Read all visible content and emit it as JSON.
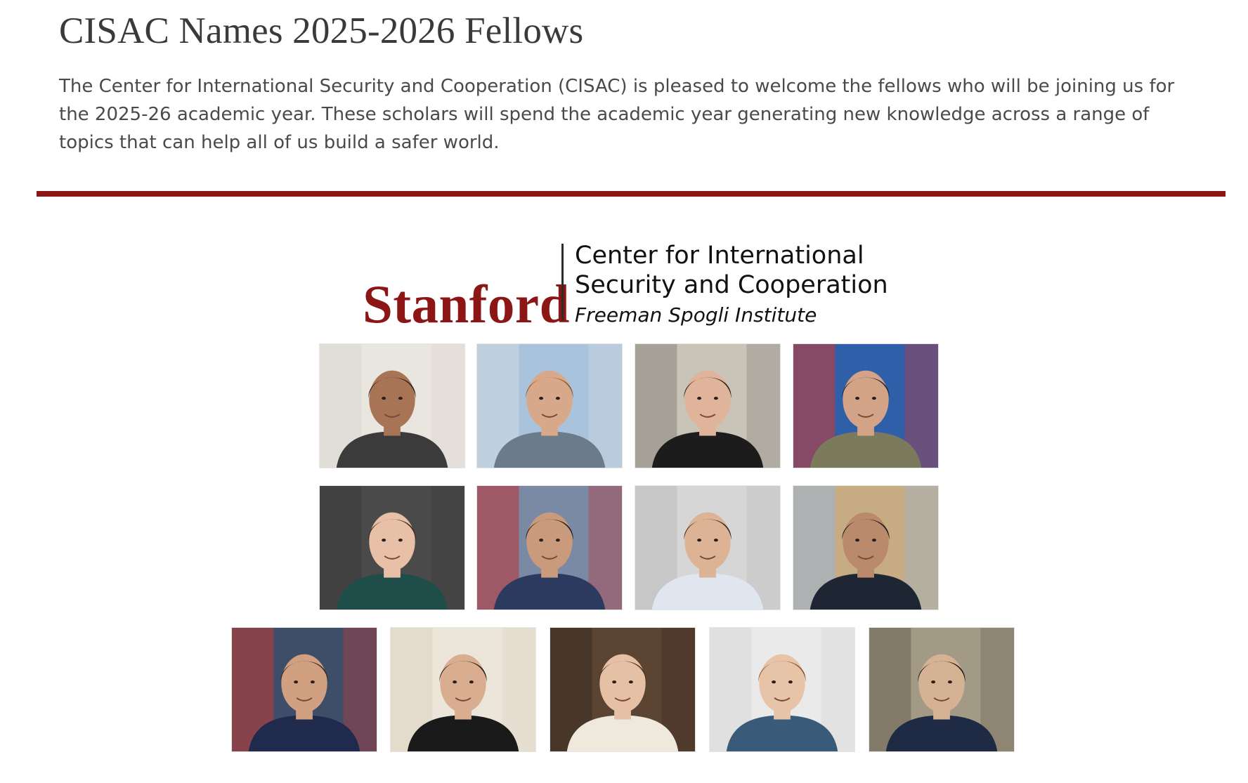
{
  "article": {
    "title": "CISAC Names 2025-2026 Fellows",
    "intro": "The Center for International Security and Cooperation (CISAC) is pleased to welcome the fellows who will be joining us for the 2025-26 academic year. These scholars will spend the academic year generating new knowledge across a range of topics that can help all of us build a safer world."
  },
  "logo": {
    "wordmark": "Stanford",
    "line1": "Center for International",
    "line2": "Security and Cooperation",
    "line3": "Freeman Spogli Institute"
  },
  "colors": {
    "accent": "#8c1515",
    "text": "#3f3f3f"
  },
  "photos": [
    {
      "bg": "#e9e6e0",
      "bg2": "#dcd8d0",
      "skin": "#a87456",
      "hair": "#2a221d",
      "shirt": "#3b3b3b"
    },
    {
      "bg": "#a9c3dd",
      "bg2": "#cfd9e0",
      "skin": "#d8a88a",
      "hair": "#8a5a2e",
      "shirt": "#6b7b8a"
    },
    {
      "bg": "#c9c4b8",
      "bg2": "#8f8a7f",
      "skin": "#e0b49a",
      "hair": "#2b1e18",
      "shirt": "#1c1c1c"
    },
    {
      "bg": "#2f5fa8",
      "bg2": "#c23b3b",
      "skin": "#d3a388",
      "hair": "#2e2620",
      "shirt": "#7b7a5d"
    },
    {
      "bg": "#4a4a4a",
      "bg2": "#3c3c3c",
      "skin": "#e8c0a8",
      "hair": "#3a2418",
      "shirt": "#1f4e4a"
    },
    {
      "bg": "#7a8aa5",
      "bg2": "#b8393c",
      "skin": "#c99a7c",
      "hair": "#1f1a17",
      "shirt": "#2b3a5e"
    },
    {
      "bg": "#d6d6d6",
      "bg2": "#bdbdbd",
      "skin": "#dcb394",
      "hair": "#3a2319",
      "shirt": "#dfe6ef"
    },
    {
      "bg": "#c7ab82",
      "bg2": "#9cb6d2",
      "skin": "#b98a6c",
      "hair": "#1a1512",
      "shirt": "#1f2633"
    },
    {
      "bg": "#3f4e68",
      "bg2": "#b73b3b",
      "skin": "#d0a080",
      "hair": "#3b2a1c",
      "shirt": "#1f2a4d"
    },
    {
      "bg": "#ece6da",
      "bg2": "#ddd3c3",
      "skin": "#d8ad90",
      "hair": "#221814",
      "shirt": "#1a1a1a"
    },
    {
      "bg": "#5c4432",
      "bg2": "#3b2d22",
      "skin": "#e6c0a4",
      "hair": "#4a3222",
      "shirt": "#efe9dd"
    },
    {
      "bg": "#eaeaea",
      "bg2": "#d8d8d8",
      "skin": "#e7c3a8",
      "hair": "#8a5430",
      "shirt": "#3a5a7a"
    },
    {
      "bg": "#a39a86",
      "bg2": "#6f6656",
      "skin": "#d6b294",
      "hair": "#1b1714",
      "shirt": "#1f2a44"
    }
  ]
}
